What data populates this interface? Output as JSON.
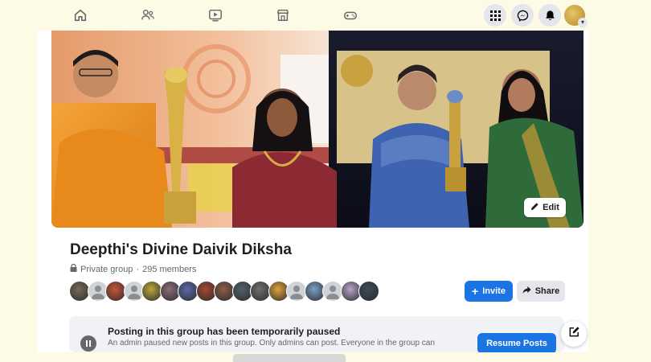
{
  "nav": {
    "icons": [
      "home-icon",
      "friends-icon",
      "watch-icon",
      "marketplace-icon",
      "gaming-icon"
    ],
    "right_icons": [
      "menu-grid-icon",
      "messenger-icon",
      "notifications-icon",
      "profile-avatar"
    ]
  },
  "cover": {
    "edit_label": "Edit"
  },
  "group": {
    "name": "Deepthi's Divine Daivik Diksha",
    "privacy": "Private group",
    "separator": "·",
    "member_count": "295 members",
    "member_avatar_count": 17,
    "invite_label": "Invite",
    "invite_plus": "+",
    "share_label": "Share"
  },
  "notice": {
    "title": "Posting in this group has been temporarily paused",
    "text": "An admin paused new posts in this group. Only admins can post. Everyone in the group can",
    "resume_label": "Resume Posts"
  },
  "colors": {
    "accent": "#1b74e4",
    "page_bg": "#fdfbe6",
    "secondary_btn": "#e4e6eb"
  }
}
